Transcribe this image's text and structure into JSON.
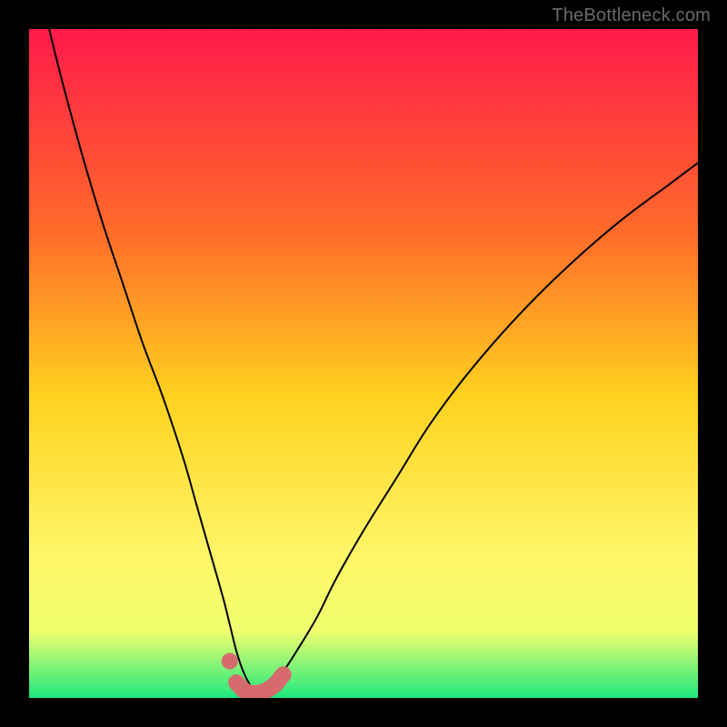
{
  "watermark": "TheBottleneck.com",
  "colors": {
    "frame": "#000000",
    "grad_top": "#ff1a4b",
    "grad_mid1": "#ff6a2a",
    "grad_mid2": "#ffd21f",
    "grad_mid3": "#fff566",
    "grad_mid4": "#f1ff6e",
    "grad_bottom": "#1ee87e",
    "curve": "#000000",
    "marker_fill": "#d76a6d",
    "marker_stroke": "#d76a6d"
  },
  "chart_data": {
    "type": "line",
    "title": "",
    "xlabel": "",
    "ylabel": "",
    "xlim": [
      0,
      100
    ],
    "ylim": [
      0,
      100
    ],
    "annotations": [
      "TheBottleneck.com"
    ],
    "series": [
      {
        "name": "bottleneck-curve",
        "x": [
          3,
          5,
          8,
          11,
          14,
          17,
          20,
          23,
          25,
          27,
          29,
          30,
          31,
          32,
          33,
          34,
          35,
          36,
          38,
          40,
          43,
          46,
          50,
          55,
          60,
          66,
          73,
          80,
          88,
          96,
          100
        ],
        "values": [
          100,
          92,
          81,
          71,
          62,
          53,
          45,
          36,
          29,
          22,
          15,
          11,
          7,
          4,
          2,
          0.7,
          0.7,
          2,
          4,
          7,
          12,
          18,
          25,
          33,
          41,
          49,
          57,
          64,
          71,
          77,
          80
        ]
      },
      {
        "name": "highlight-markers",
        "x": [
          30,
          31,
          32,
          33,
          34,
          35,
          36,
          37,
          38
        ],
        "values": [
          5.5,
          2.3,
          1.2,
          0.7,
          0.7,
          0.9,
          1.4,
          2.2,
          3.5
        ]
      }
    ]
  }
}
